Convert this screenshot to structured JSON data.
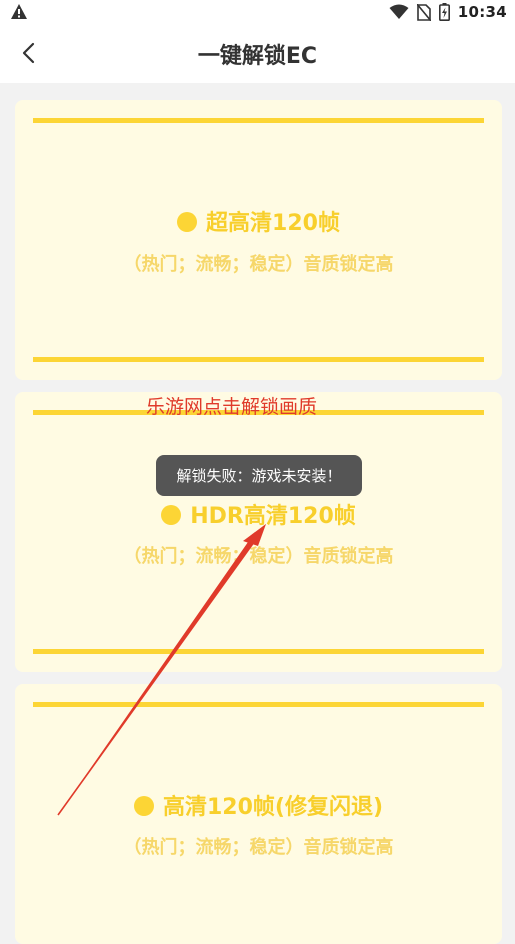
{
  "status_bar": {
    "time": "10:34",
    "icons": [
      "warning-icon",
      "wifi-icon",
      "no-sim-icon",
      "battery-icon"
    ]
  },
  "app_bar": {
    "title": "一键解锁EC",
    "back_icon": "chevron-left-icon"
  },
  "cards": [
    {
      "name": "超高清120帧",
      "desc": "（热门；流畅；稳定）音质锁定高"
    },
    {
      "name": "HDR高清120帧",
      "desc": "（热门；流畅；稳定）音质锁定高"
    },
    {
      "name": "高清120帧(修复闪退)",
      "desc": "（热门；流畅；稳定）音质锁定高"
    }
  ],
  "toast": {
    "message": "解锁失败：游戏未安装！"
  },
  "annotation": {
    "text": "乐游网点击解锁画质"
  },
  "colors": {
    "accent_yellow": "#fcd535",
    "card_background": "#fffbe3",
    "annotation_red": "#e03a2a",
    "toast_background": "#555555"
  }
}
